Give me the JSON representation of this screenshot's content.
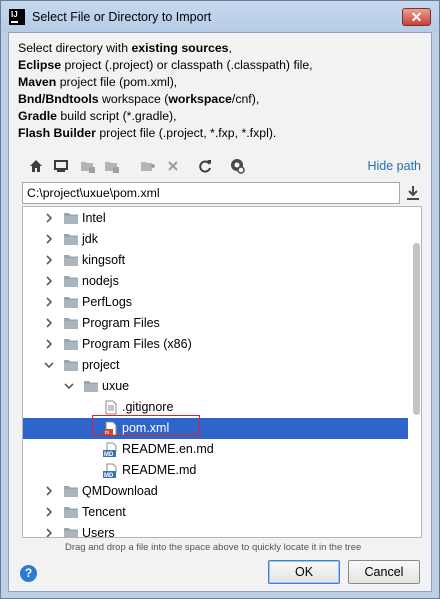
{
  "window": {
    "title": "Select File or Directory to Import",
    "app_icon_text": "IJ",
    "close_label": "✕"
  },
  "description": {
    "line1": {
      "prefix": "Select directory with ",
      "bold": "existing sources",
      "suffix": ","
    },
    "line2": {
      "bold": "Eclipse",
      "suffix": " project (.project) or classpath (.classpath) file,"
    },
    "line3": {
      "bold": "Maven",
      "suffix": " project file (pom.xml),"
    },
    "line4": {
      "bold": "Bnd/Bndtools",
      "middle": " workspace (",
      "bold2": "workspace",
      "suffix": "/cnf),"
    },
    "line5": {
      "bold": "Gradle",
      "suffix": " build script (*.gradle),"
    },
    "line6": {
      "bold": "Flash Builder",
      "suffix": " project file (.project, *.fxp, *.fxpl)."
    }
  },
  "toolbar": {
    "icons": [
      "home-icon",
      "desktop-icon",
      "project-folder-icon",
      "module-folder-icon",
      "new-folder-icon",
      "delete-icon",
      "refresh-icon",
      "show-hidden-icon"
    ],
    "hide_path_label": "Hide path"
  },
  "path_input": {
    "value": "C:\\project\\uxue\\pom.xml"
  },
  "tree": {
    "items": [
      {
        "label": "Intel",
        "type": "folder",
        "expanded": false
      },
      {
        "label": "jdk",
        "type": "folder",
        "expanded": false
      },
      {
        "label": "kingsoft",
        "type": "folder",
        "expanded": false
      },
      {
        "label": "nodejs",
        "type": "folder",
        "expanded": false
      },
      {
        "label": "PerfLogs",
        "type": "folder",
        "expanded": false
      },
      {
        "label": "Program Files",
        "type": "folder",
        "expanded": false
      },
      {
        "label": "Program Files (x86)",
        "type": "folder",
        "expanded": false
      },
      {
        "label": "project",
        "type": "folder",
        "expanded": true
      },
      {
        "label": "uxue",
        "type": "folder",
        "expanded": true
      },
      {
        "label": ".gitignore",
        "type": "file"
      },
      {
        "label": "pom.xml",
        "type": "maven-file",
        "selected": true
      },
      {
        "label": "README.en.md",
        "type": "md-file",
        "badge": "MD"
      },
      {
        "label": "README.md",
        "type": "md-file",
        "badge": "MD"
      },
      {
        "label": "QMDownload",
        "type": "folder",
        "expanded": false
      },
      {
        "label": "Tencent",
        "type": "folder",
        "expanded": false
      },
      {
        "label": "Users",
        "type": "folder",
        "expanded": false
      }
    ]
  },
  "hint": "Drag and drop a file into the space above to quickly locate it in the tree",
  "buttons": {
    "help": "?",
    "ok": "OK",
    "cancel": "Cancel"
  },
  "colors": {
    "selection": "#2f65ca",
    "link": "#2470b3",
    "highlight_box": "#d9242b"
  }
}
